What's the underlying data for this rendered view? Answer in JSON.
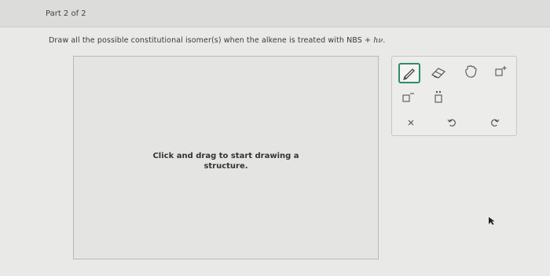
{
  "header": {
    "part_label": "Part 2 of 2"
  },
  "question": {
    "prompt_prefix": "Draw all the possible constitutional isomer(s) when the alkene is treated with NBS + ",
    "prompt_symbol": "hν."
  },
  "canvas": {
    "hint": "Click and drag to start drawing a structure."
  },
  "toolbar": {
    "tools": [
      {
        "name": "pencil-draw-tool",
        "icon": "pencil-icon",
        "active": true
      },
      {
        "name": "eraser-tool",
        "icon": "eraser-icon",
        "active": false
      },
      {
        "name": "hand-move-tool",
        "icon": "hand-icon",
        "active": false
      },
      {
        "name": "charge-plus-tool",
        "icon": "charge-plus-icon",
        "active": false
      },
      {
        "name": "charge-minus-tool",
        "icon": "charge-minus-icon",
        "active": false
      },
      {
        "name": "lone-pair-tool",
        "icon": "lone-pair-icon",
        "active": false
      },
      {
        "name": "clear-button",
        "icon": "close-icon",
        "active": false
      },
      {
        "name": "undo-button",
        "icon": "undo-icon",
        "active": false
      },
      {
        "name": "redo-button",
        "icon": "redo-icon",
        "active": false
      }
    ]
  },
  "colors": {
    "accent": "#2e8b6d",
    "background": "#e9e9e7",
    "header": "#dcdcda"
  }
}
